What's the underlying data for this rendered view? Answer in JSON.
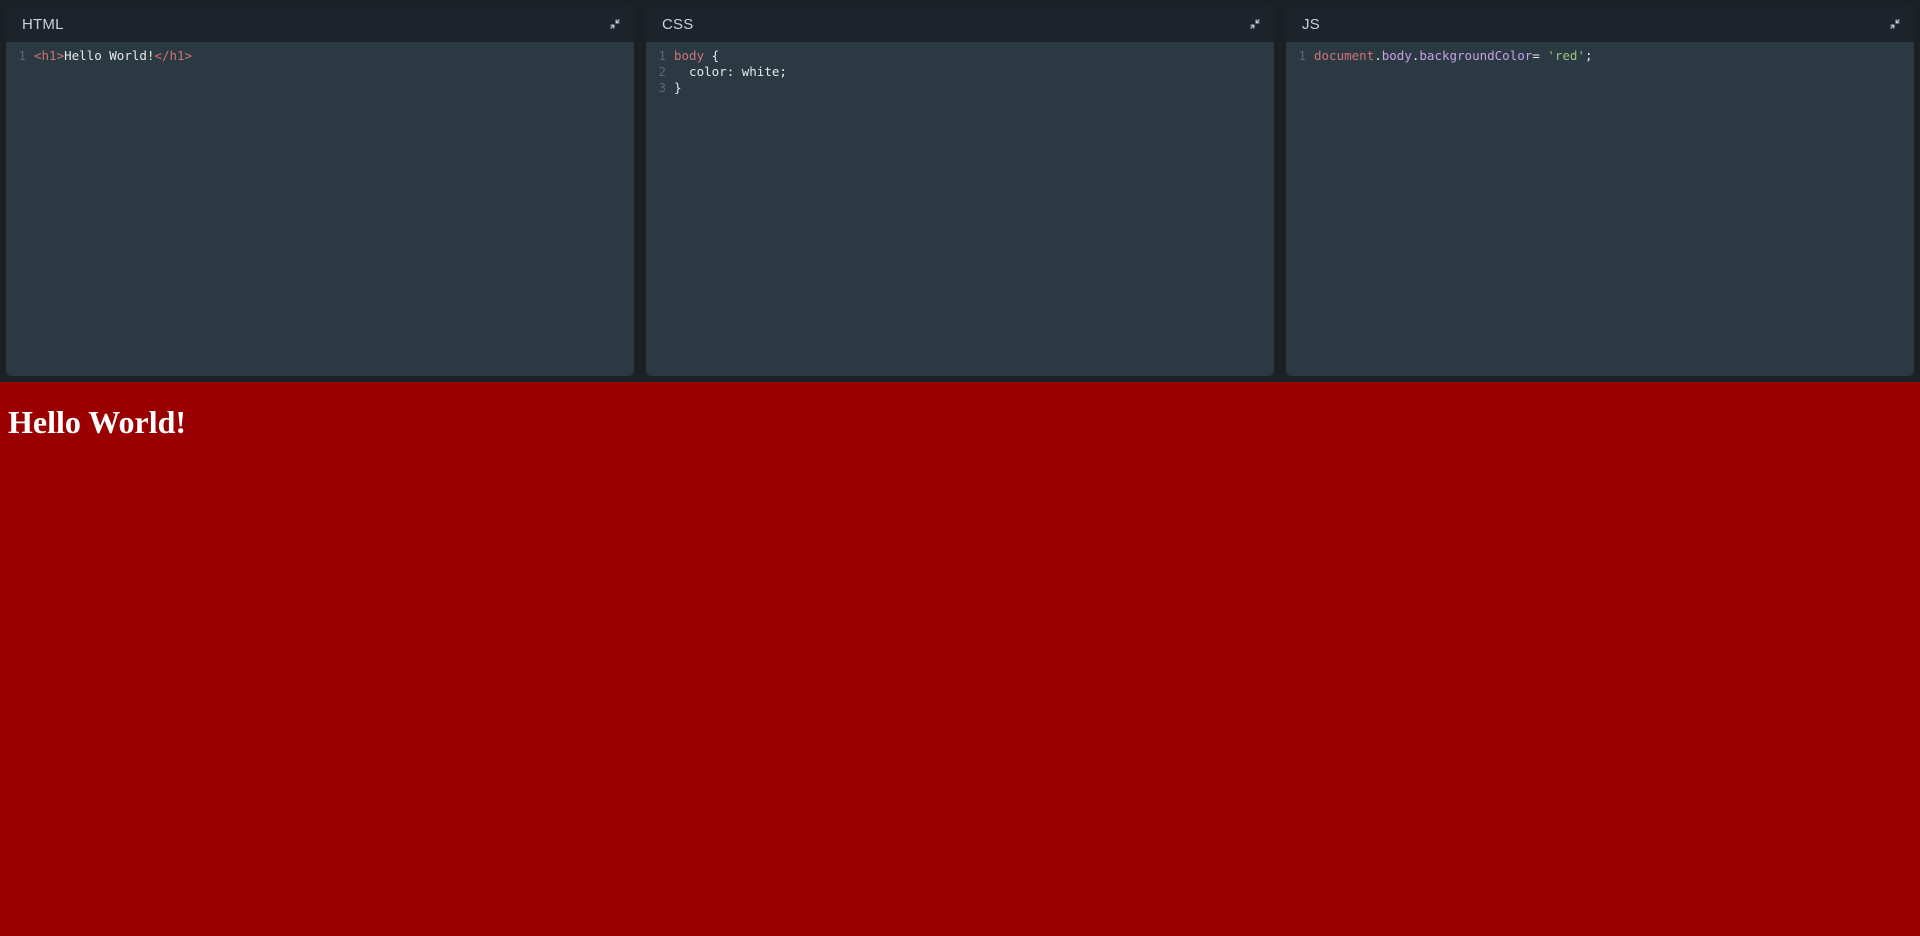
{
  "panels": {
    "html": {
      "title": "HTML"
    },
    "css": {
      "title": "CSS"
    },
    "js": {
      "title": "JS"
    }
  },
  "code": {
    "html": {
      "gutter": [
        "1"
      ],
      "tokens": [
        [
          {
            "t": "<h1>",
            "c": "tok-tag"
          },
          {
            "t": "Hello World!",
            "c": "tok-text"
          },
          {
            "t": "</h1>",
            "c": "tok-tag"
          }
        ]
      ]
    },
    "css": {
      "gutter": [
        "1",
        "2",
        "3"
      ],
      "tokens": [
        [
          {
            "t": "body",
            "c": "tok-sel"
          },
          {
            "t": " {",
            "c": "tok-brace"
          }
        ],
        [
          {
            "t": "  color",
            "c": "tok-prop"
          },
          {
            "t": ": ",
            "c": "tok-brace"
          },
          {
            "t": "white",
            "c": "tok-val"
          },
          {
            "t": ";",
            "c": "tok-brace"
          }
        ],
        [
          {
            "t": "}",
            "c": "tok-brace"
          }
        ]
      ]
    },
    "js": {
      "gutter": [
        "1"
      ],
      "tokens": [
        [
          {
            "t": "document",
            "c": "tok-document"
          },
          {
            "t": ".",
            "c": "tok-op"
          },
          {
            "t": "body",
            "c": "tok-member"
          },
          {
            "t": ".",
            "c": "tok-op"
          },
          {
            "t": "backgroundColor",
            "c": "tok-member"
          },
          {
            "t": "= ",
            "c": "tok-op"
          },
          {
            "t": "'red'",
            "c": "tok-str"
          },
          {
            "t": ";",
            "c": "tok-op"
          }
        ]
      ]
    }
  },
  "preview": {
    "heading": "Hello World!",
    "backgroundColor": "#9a0000",
    "textColor": "#ffffff"
  }
}
